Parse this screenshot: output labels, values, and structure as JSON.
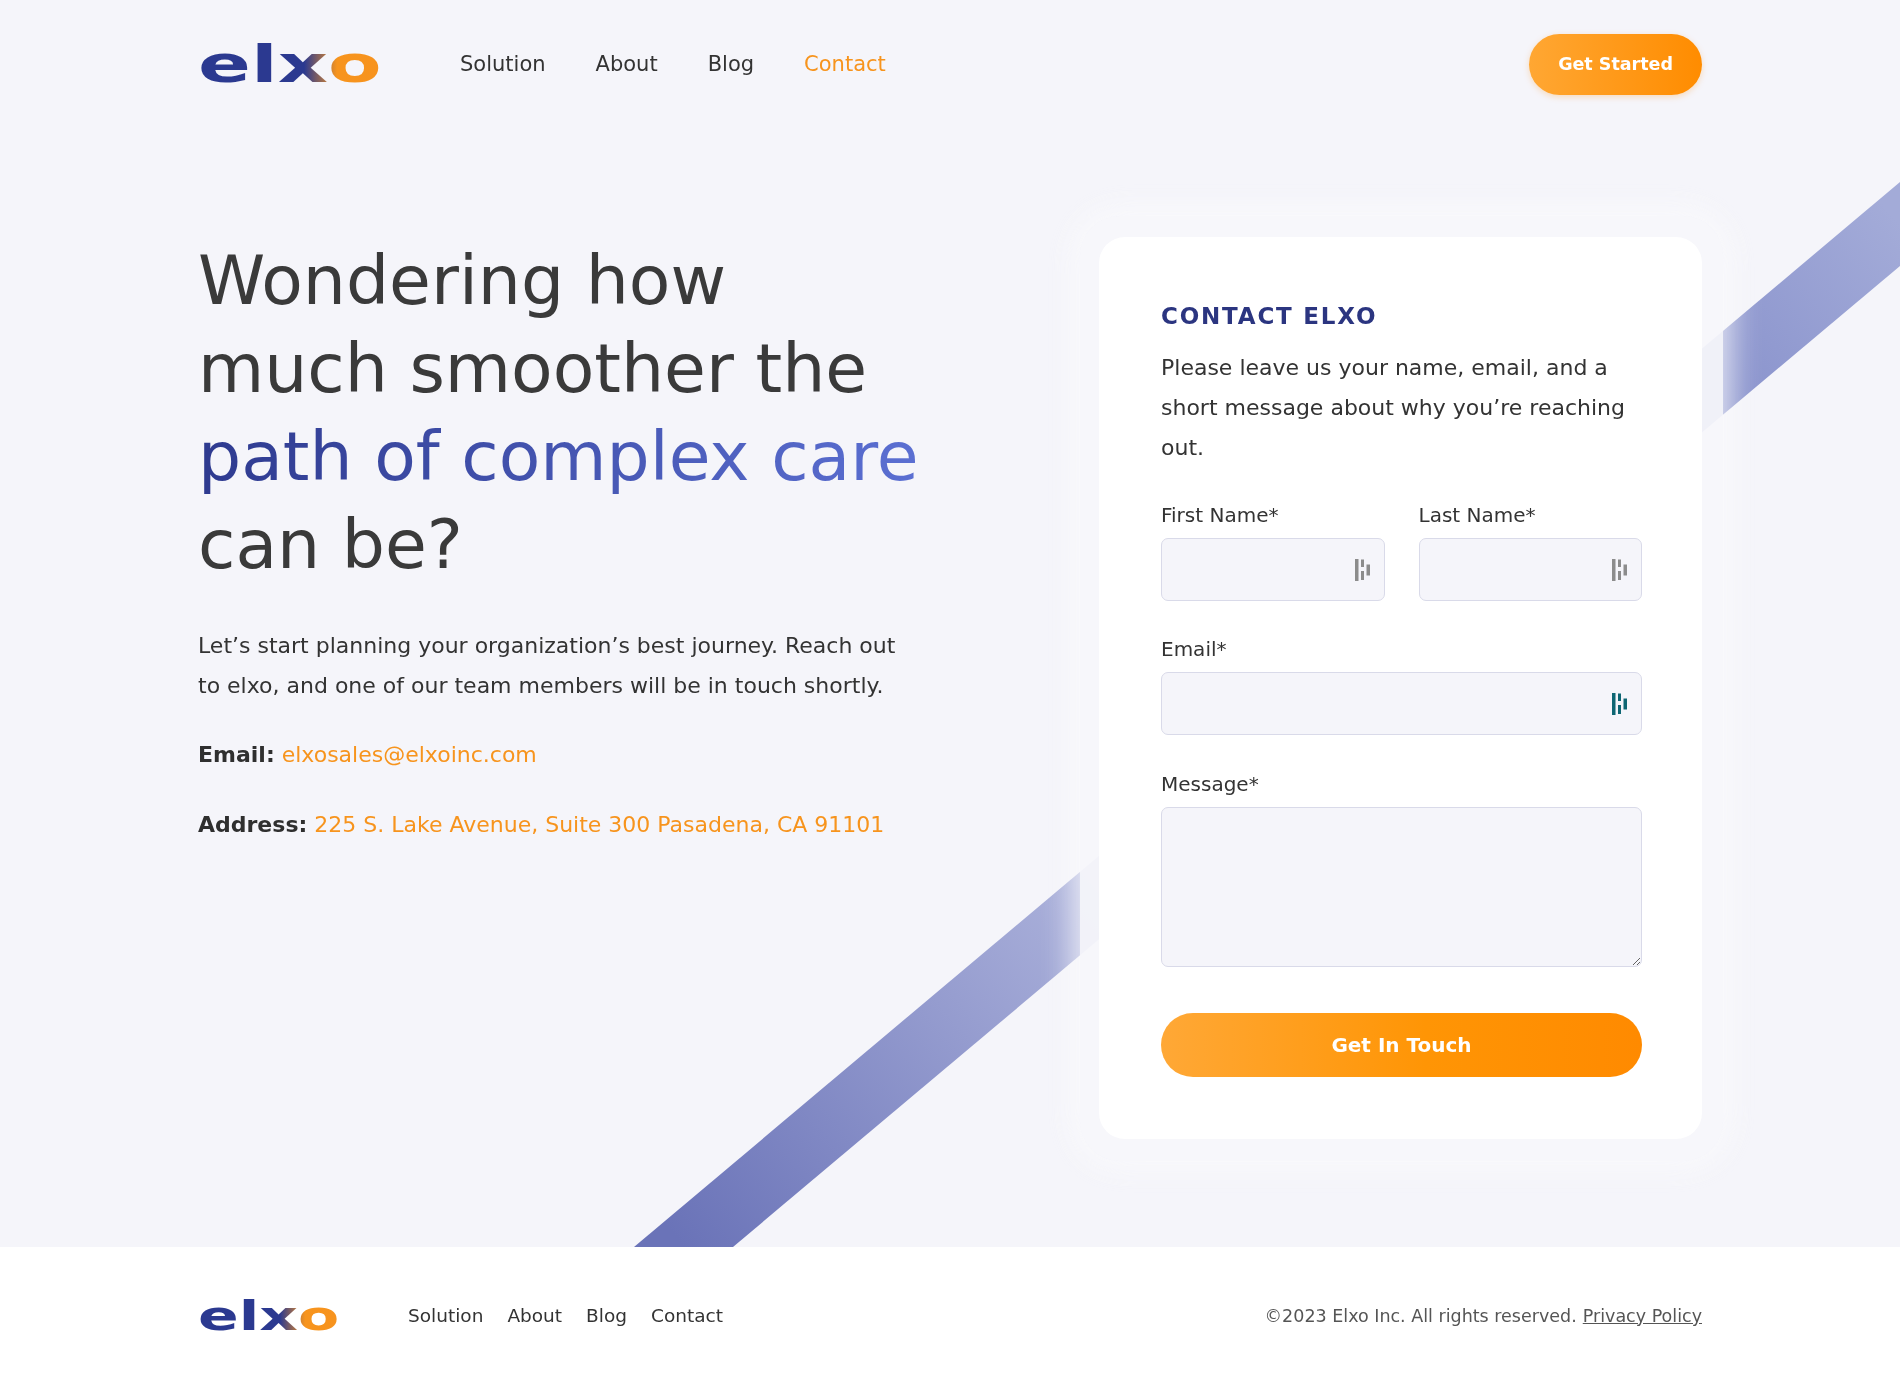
{
  "header": {
    "logo": "elxo",
    "nav": [
      {
        "label": "Solution",
        "selected": false
      },
      {
        "label": "About",
        "selected": false
      },
      {
        "label": "Blog",
        "selected": false
      },
      {
        "label": "Contact",
        "selected": true
      }
    ],
    "cta": "Get Started"
  },
  "hero": {
    "heading_lines": [
      {
        "text": "Wondering how",
        "highlight": false
      },
      {
        "text": "much smoother the",
        "highlight": false
      },
      {
        "text": "path of complex care",
        "highlight": true
      },
      {
        "text": "can be?",
        "highlight": false
      }
    ],
    "intro": "Let’s start planning your organization’s best journey. Reach out to elxo, and one of our team members will be in touch shortly.",
    "contacts": [
      {
        "label": "Email:",
        "value": "elxosales@elxoinc.com"
      },
      {
        "label": "Address:",
        "value": "225 S. Lake Avenue, Suite 300 Pasadena, CA 91101"
      }
    ]
  },
  "contact_form": {
    "title": "CONTACT ELXO",
    "description": "Please leave us your name, email, and a short message about why you’re reaching out.",
    "name_fields": [
      {
        "label": "First Name*",
        "icon_active": false
      },
      {
        "label": "Last Name*",
        "icon_active": false
      }
    ],
    "email_field": {
      "label": "Email*",
      "icon_active": true
    },
    "message_field": {
      "label": "Message*"
    },
    "submit": "Get In Touch"
  },
  "footer": {
    "logo": "elxo",
    "nav": [
      "Solution",
      "About",
      "Blog",
      "Contact"
    ],
    "copyright": "©2023 Elxo Inc. All rights reserved.",
    "privacy_link": "Privacy Policy"
  }
}
